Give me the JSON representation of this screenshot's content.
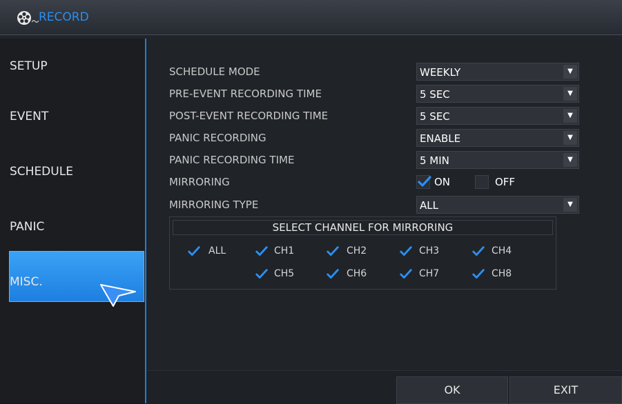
{
  "title": {
    "text": "RECORD"
  },
  "sidebar": {
    "items": [
      {
        "label": "SETUP"
      },
      {
        "label": "EVENT"
      },
      {
        "label": "SCHEDULE"
      },
      {
        "label": "PANIC"
      },
      {
        "label": "MISC.",
        "active": true
      }
    ]
  },
  "settings": {
    "schedule_mode": {
      "label": "SCHEDULE MODE",
      "value": "WEEKLY"
    },
    "pre_event": {
      "label": "PRE-EVENT RECORDING TIME",
      "value": "5 SEC"
    },
    "post_event": {
      "label": "POST-EVENT RECORDING TIME",
      "value": "5 SEC"
    },
    "panic_recording": {
      "label": "PANIC RECORDING",
      "value": "ENABLE"
    },
    "panic_time": {
      "label": "PANIC RECORDING TIME",
      "value": "5 MIN"
    },
    "mirroring": {
      "label": "MIRRORING",
      "on_label": "ON",
      "off_label": "OFF",
      "on_checked": true,
      "off_checked": false
    },
    "mirroring_type": {
      "label": "MIRRORING TYPE",
      "value": "ALL"
    }
  },
  "channels": {
    "header": "SELECT CHANNEL FOR MIRRORING",
    "all_label": "ALL",
    "row1": [
      "CH1",
      "CH2",
      "CH3",
      "CH4"
    ],
    "row2": [
      "CH5",
      "CH6",
      "CH7",
      "CH8"
    ]
  },
  "buttons": {
    "ok": "OK",
    "exit": "EXIT"
  },
  "colors": {
    "accent": "#1f86e8",
    "check": "#2a8ff0"
  }
}
